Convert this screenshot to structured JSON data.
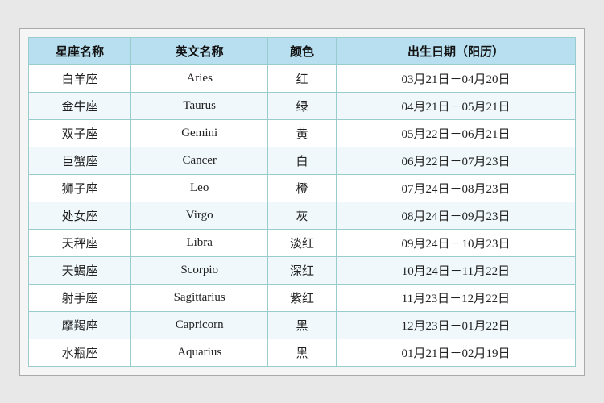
{
  "table": {
    "headers": [
      "星座名称",
      "英文名称",
      "颜色",
      "出生日期（阳历）"
    ],
    "rows": [
      {
        "cn": "白羊座",
        "en": "Aries",
        "color": "红",
        "date": "03月21日－04月20日"
      },
      {
        "cn": "金牛座",
        "en": "Taurus",
        "color": "绿",
        "date": "04月21日－05月21日"
      },
      {
        "cn": "双子座",
        "en": "Gemini",
        "color": "黄",
        "date": "05月22日－06月21日"
      },
      {
        "cn": "巨蟹座",
        "en": "Cancer",
        "color": "白",
        "date": "06月22日－07月23日"
      },
      {
        "cn": "狮子座",
        "en": "Leo",
        "color": "橙",
        "date": "07月24日－08月23日"
      },
      {
        "cn": "处女座",
        "en": "Virgo",
        "color": "灰",
        "date": "08月24日－09月23日"
      },
      {
        "cn": "天秤座",
        "en": "Libra",
        "color": "淡红",
        "date": "09月24日－10月23日"
      },
      {
        "cn": "天蝎座",
        "en": "Scorpio",
        "color": "深红",
        "date": "10月24日－11月22日"
      },
      {
        "cn": "射手座",
        "en": "Sagittarius",
        "color": "紫红",
        "date": "11月23日－12月22日"
      },
      {
        "cn": "摩羯座",
        "en": "Capricorn",
        "color": "黑",
        "date": "12月23日－01月22日"
      },
      {
        "cn": "水瓶座",
        "en": "Aquarius",
        "color": "黑",
        "date": "01月21日－02月19日"
      }
    ]
  }
}
